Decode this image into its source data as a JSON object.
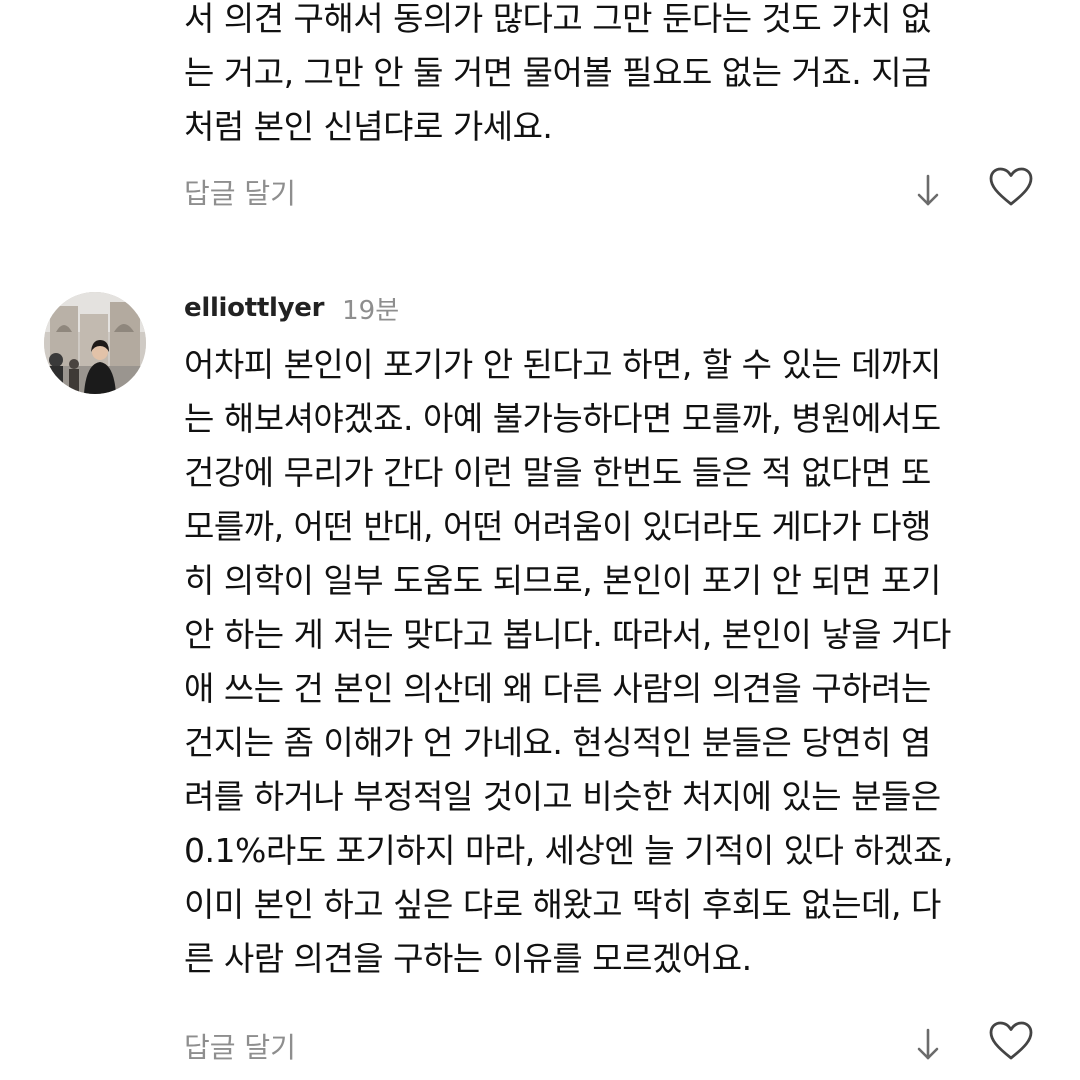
{
  "comments": [
    {
      "text": "서 의견 구해서 동의가 많다고 그만 둔다는 것도 가치 없\n는 거고, 그만 안 둘 거면 물어볼 필요도 없는 거죠. 지금\n처럼 본인 신념댜로 가세요.",
      "reply_label": "답글 달기",
      "icons": {
        "down": "down-arrow-icon",
        "like": "heart-outline-icon"
      }
    },
    {
      "username": "elliottlyer",
      "time": "19분",
      "avatar": "user-avatar-photo",
      "text": "어차피 본인이 포기가 안 된다고 하면, 할 수 있는 데까지\n는 해보셔야겠죠. 아예 불가능하다면 모를까, 병원에서도\n건강에 무리가 간다 이런 말을 한번도 들은 적 없다면 또\n모를까, 어떤 반대, 어떤 어려움이 있더라도 게다가 다행\n히 의학이 일부 도움도 되므로, 본인이 포기 안 되면 포기\n안 하는 게 저는 맞다고 봅니다. 따라서, 본인이 낳을 거다\n애 쓰는 건 본인 의산데 왜 다른 사람의 의견을 구하려는\n건지는 좀 이해가 언 가네요. 현싱적인 분들은 당연히 염\n려를 하거나 부정적일 것이고 비슷한 처지에 있는 분들은\n0.1%라도 포기하지 마라, 세상엔 늘 기적이 있다 하겠죠,\n이미 본인 하고 싶은 댜로 해왔고 딱히 후회도 없는데, 다\n른 사람 의견을 구하는 이유를 모르겠어요.",
      "reply_label": "답글 달기",
      "icons": {
        "down": "down-arrow-icon",
        "like": "heart-outline-icon"
      }
    }
  ],
  "colors": {
    "text": "#111111",
    "secondary": "#8e8e8e",
    "background": "#ffffff"
  }
}
